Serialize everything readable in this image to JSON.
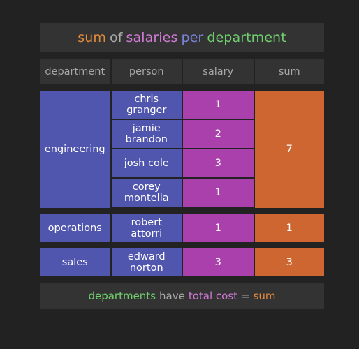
{
  "title": {
    "tokens": [
      {
        "text": "sum",
        "color": "#e08a3c"
      },
      {
        "text": "of",
        "color": "#a9a9a9"
      },
      {
        "text": "salaries",
        "color": "#d07ad5"
      },
      {
        "text": "per",
        "color": "#7b84d8"
      },
      {
        "text": "department",
        "color": "#71cf6e"
      }
    ],
    "full_text": "sum of salaries per department"
  },
  "columns": [
    {
      "key": "department",
      "label": "department"
    },
    {
      "key": "person",
      "label": "person"
    },
    {
      "key": "salary",
      "label": "salary"
    },
    {
      "key": "sum",
      "label": "sum"
    }
  ],
  "groups": [
    {
      "department": "engineering",
      "sum": "7",
      "rows": [
        {
          "person": "chris\ngranger",
          "salary": "1"
        },
        {
          "person": "jamie\nbrandon",
          "salary": "2"
        },
        {
          "person": "josh cole",
          "salary": "3"
        },
        {
          "person": "corey\nmontella",
          "salary": "1"
        }
      ]
    },
    {
      "department": "operations",
      "sum": "1",
      "rows": [
        {
          "person": "robert\nattorri",
          "salary": "1"
        }
      ]
    },
    {
      "department": "sales",
      "sum": "3",
      "rows": [
        {
          "person": "edward\nnorton",
          "salary": "3"
        }
      ]
    }
  ],
  "footer": {
    "tokens": [
      {
        "text": "departments",
        "color": "#71cf6e"
      },
      {
        "text": "have",
        "color": "#a9a9a9"
      },
      {
        "text": "total cost",
        "color": "#d07ad5"
      },
      {
        "text": "=",
        "color": "#a9a9a9"
      },
      {
        "text": "sum",
        "color": "#e08a3c"
      }
    ],
    "full_text": "departments have total cost = sum"
  },
  "colors": {
    "background": "#222222",
    "panel": "#333333",
    "department_cell": "#5055ad",
    "salary_cell": "#a940ab",
    "sum_cell": "#cd6630",
    "header_text": "#a8a8a8",
    "cell_text": "#ffffff"
  }
}
